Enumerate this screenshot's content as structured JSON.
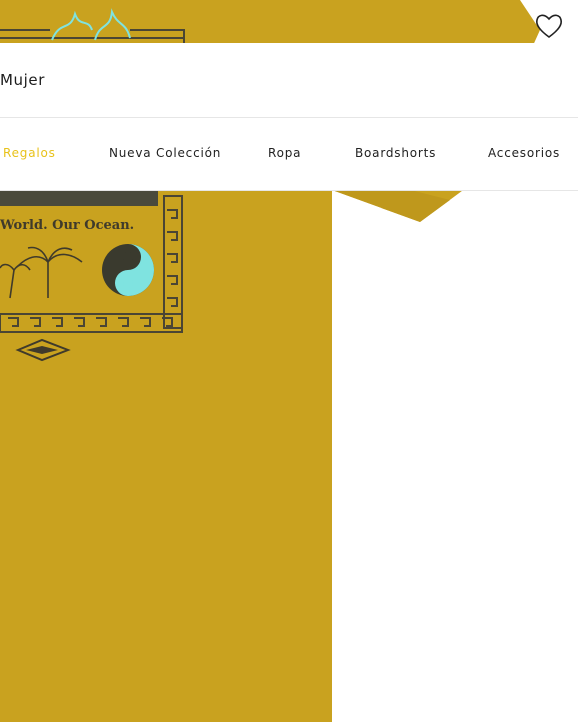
{
  "header": {
    "title": "Mujer"
  },
  "nav": {
    "items": [
      {
        "label": "Regalos"
      },
      {
        "label": "Nueva Colección"
      },
      {
        "label": "Ropa"
      },
      {
        "label": "Boardshorts"
      },
      {
        "label": "Accesorios"
      }
    ],
    "active_color": "#e8c21a"
  },
  "product": {
    "shirt_color": "#c9a21f",
    "print_text": "World. Our Ocean."
  },
  "icons": {
    "favorite": "heart-outline-icon"
  }
}
